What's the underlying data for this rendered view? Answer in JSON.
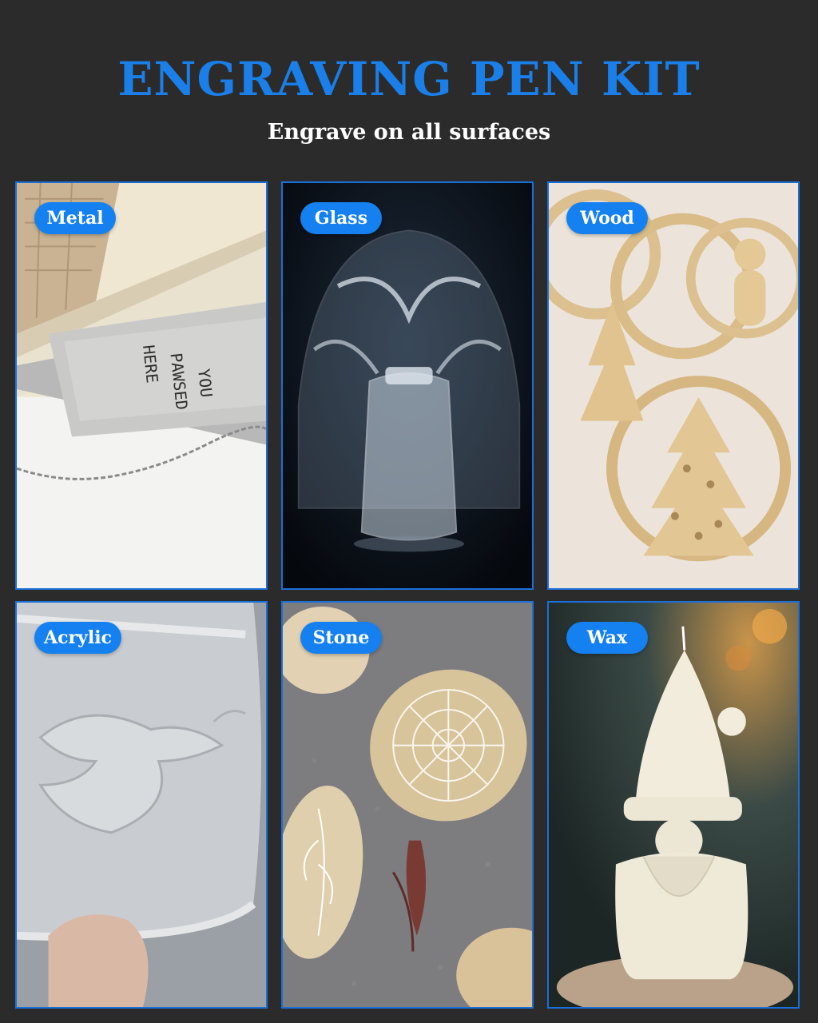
{
  "header": {
    "title": "ENGRAVING PEN KIT",
    "subtitle": "Engrave on all surfaces"
  },
  "surfaces": [
    {
      "label": "Metal"
    },
    {
      "label": "Glass"
    },
    {
      "label": "Wood"
    },
    {
      "label": "Acrylic"
    },
    {
      "label": "Stone"
    },
    {
      "label": "Wax"
    }
  ],
  "metal_tag_text": [
    "YOU",
    "PAWSED",
    "HERE"
  ],
  "colors": {
    "background": "#2b2b2b",
    "accent_blue": "#1a7fe8",
    "pill_blue": "#1580f0"
  }
}
